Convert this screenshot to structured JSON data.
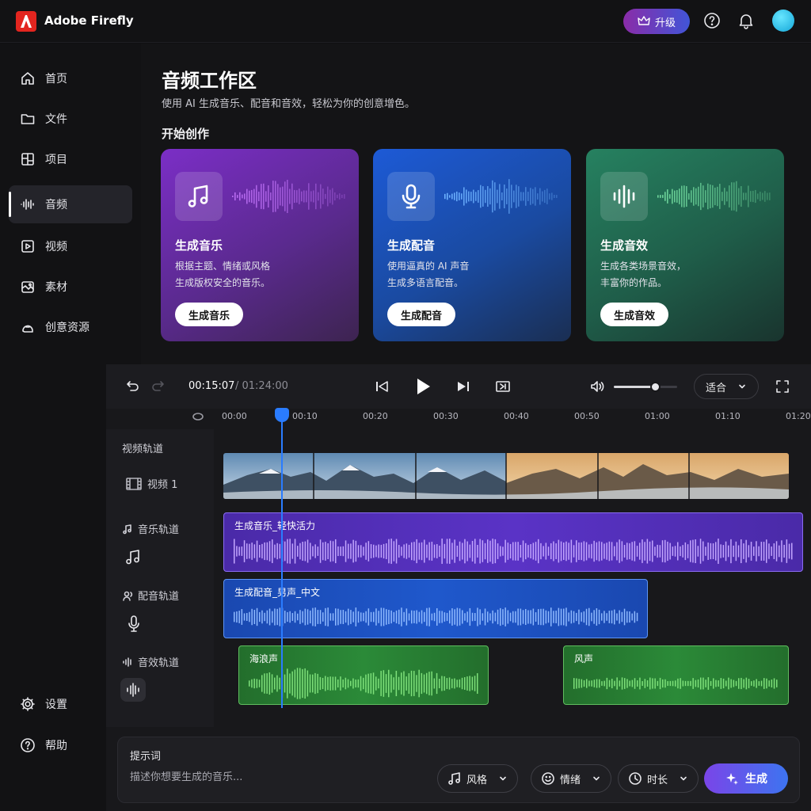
{
  "app": {
    "name": "Adobe Firefly",
    "upgrade_label": "升级"
  },
  "sidebar": {
    "items": [
      {
        "label": "首页",
        "icon": "home-icon"
      },
      {
        "label": "文件",
        "icon": "folder-icon"
      },
      {
        "label": "项目",
        "icon": "project-icon"
      },
      {
        "label": "音频",
        "icon": "audio-wave-icon",
        "active": true
      },
      {
        "label": "视频",
        "icon": "video-icon"
      },
      {
        "label": "素材",
        "icon": "assets-icon"
      },
      {
        "label": "创意资源",
        "icon": "creative-resources-icon"
      }
    ],
    "bottom": [
      {
        "label": "设置",
        "icon": "gear-icon"
      },
      {
        "label": "帮助",
        "icon": "help-icon"
      }
    ]
  },
  "page": {
    "title": "音频工作区",
    "subtitle": "使用 AI 生成音乐、配音和音效，轻松为你的创意增色。",
    "section_title": "开始创作"
  },
  "cards": [
    {
      "title": "生成音乐",
      "desc": "根据主题、情绪或风格\n生成版权安全的音乐。",
      "button": "生成音乐",
      "icon": "music-note-icon",
      "color": "#7b2fc4"
    },
    {
      "title": "生成配音",
      "desc": "使用逼真的 AI 声音\n生成多语言配音。",
      "button": "生成配音",
      "icon": "microphone-icon",
      "color": "#1d55c8"
    },
    {
      "title": "生成音效",
      "desc": "生成各类场景音效，\n丰富你的作品。",
      "button": "生成音效",
      "icon": "sound-wave-icon",
      "color": "#1f6a4e"
    }
  ],
  "timeline": {
    "current_time": "00:15:07",
    "total_time": "/ 01:24:00",
    "fit_label": "适合",
    "volume": 0.65,
    "ruler": [
      "00:00",
      "00:10",
      "00:20",
      "00:30",
      "00:40",
      "00:50",
      "01:00",
      "01:10",
      "01:20"
    ],
    "tracks": {
      "video_group": "视频轨道",
      "video_name": "视频 1",
      "music": "音乐轨道",
      "voice": "配音轨道",
      "sfx": "音效轨道"
    },
    "clips": {
      "music": "生成音乐_轻快活力",
      "voice": "生成配音_男声_中文",
      "sfx1": "海浪声",
      "sfx2": "风声"
    },
    "colors": {
      "music": "#5a2fc0",
      "voice": "#1f55c6",
      "sfx": "#2f8a3c",
      "playhead": "#2a7cff"
    }
  },
  "prompt": {
    "label": "提示词",
    "placeholder": "描述你想要生成的音乐...",
    "chips": [
      "风格",
      "情绪",
      "时长"
    ],
    "generate_label": "生成"
  }
}
